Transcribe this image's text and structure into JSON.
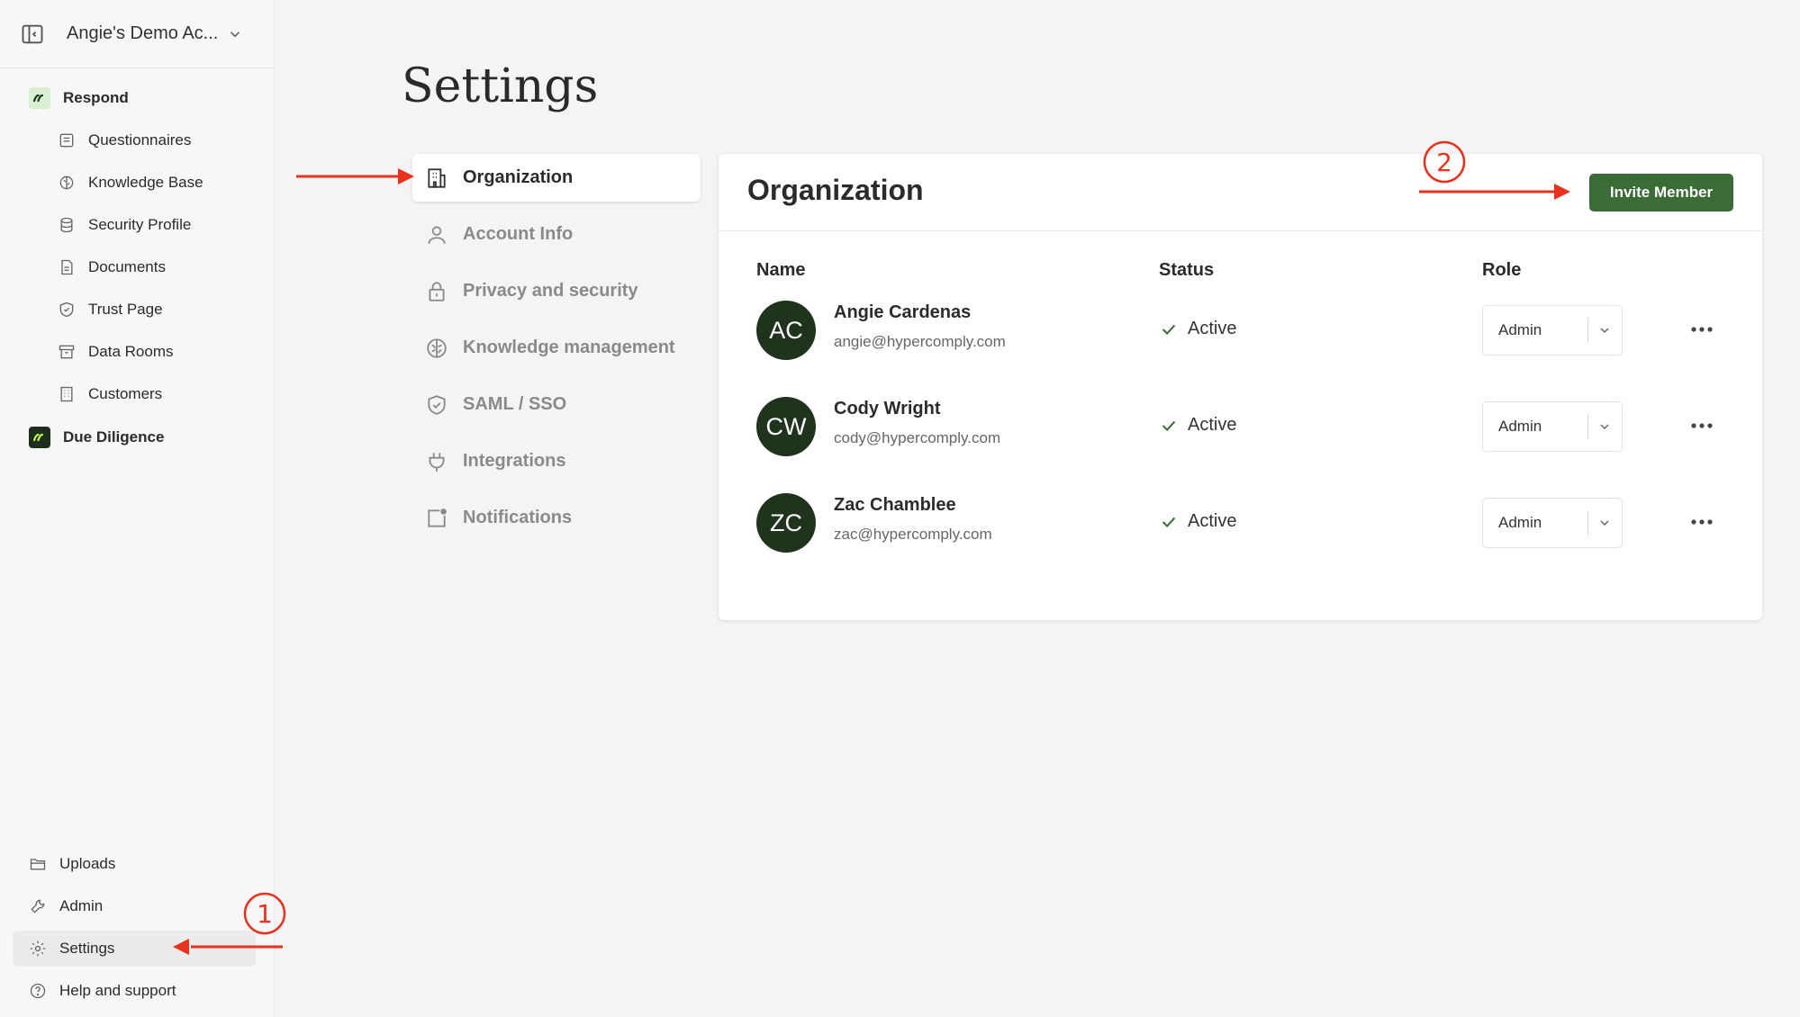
{
  "sidebar": {
    "account_name": "Angie's Demo Ac...",
    "respond_label": "Respond",
    "respond_items": [
      {
        "label": "Questionnaires",
        "icon": "list-icon"
      },
      {
        "label": "Knowledge Base",
        "icon": "brain-icon"
      },
      {
        "label": "Security Profile",
        "icon": "database-icon"
      },
      {
        "label": "Documents",
        "icon": "document-icon"
      },
      {
        "label": "Trust Page",
        "icon": "shield-icon"
      },
      {
        "label": "Data Rooms",
        "icon": "archive-icon"
      },
      {
        "label": "Customers",
        "icon": "building-icon"
      }
    ],
    "due_diligence_label": "Due Diligence",
    "bottom_items": [
      {
        "label": "Uploads",
        "icon": "folder-icon"
      },
      {
        "label": "Admin",
        "icon": "wrench-icon"
      },
      {
        "label": "Settings",
        "icon": "gear-icon"
      },
      {
        "label": "Help and support",
        "icon": "help-icon"
      }
    ]
  },
  "page": {
    "title": "Settings"
  },
  "settings_nav": [
    {
      "label": "Organization",
      "icon": "building-icon",
      "active": true
    },
    {
      "label": "Account Info",
      "icon": "user-icon"
    },
    {
      "label": "Privacy and security",
      "icon": "lock-icon"
    },
    {
      "label": "Knowledge management",
      "icon": "brain-icon"
    },
    {
      "label": "SAML / SSO",
      "icon": "shield-check-icon"
    },
    {
      "label": "Integrations",
      "icon": "plug-icon"
    },
    {
      "label": "Notifications",
      "icon": "notification-icon"
    }
  ],
  "organization": {
    "title": "Organization",
    "invite_label": "Invite Member",
    "columns": {
      "name": "Name",
      "status": "Status",
      "role": "Role"
    },
    "members": [
      {
        "initials": "AC",
        "name": "Angie Cardenas",
        "email": "angie@hypercomply.com",
        "status": "Active",
        "role": "Admin"
      },
      {
        "initials": "CW",
        "name": "Cody Wright",
        "email": "cody@hypercomply.com",
        "status": "Active",
        "role": "Admin"
      },
      {
        "initials": "ZC",
        "name": "Zac Chamblee",
        "email": "zac@hypercomply.com",
        "status": "Active",
        "role": "Admin"
      }
    ]
  },
  "annotations": {
    "step1": "1",
    "step2": "2",
    "color": "#e8321e"
  },
  "colors": {
    "accent_green": "#3b6b37",
    "avatar_bg": "#1f331d"
  }
}
